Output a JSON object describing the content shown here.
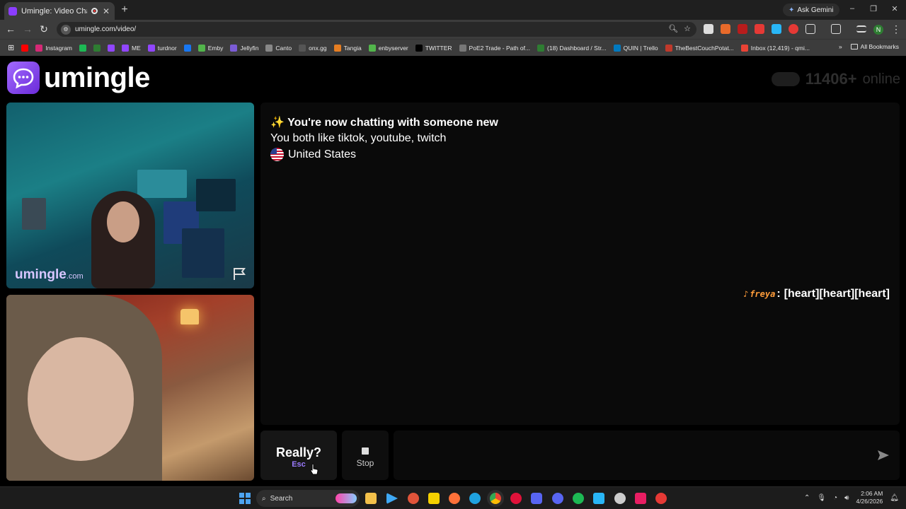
{
  "browser": {
    "tab_title": "Umingle: Video Chat with S",
    "tab_close": "✕",
    "new_tab": "+",
    "ask_gemini": "Ask Gemini",
    "url": "umingle.com/video/",
    "profile_initial": "N",
    "window_controls": [
      "–",
      "❐",
      "✕"
    ]
  },
  "bookmarks": {
    "items": [
      {
        "label": "",
        "color": "#ff0000"
      },
      {
        "label": "Instagram",
        "color": "#d62976"
      },
      {
        "label": "",
        "color": "#1db954"
      },
      {
        "label": "",
        "color": "#2e7d32"
      },
      {
        "label": "",
        "color": "#9146ff"
      },
      {
        "label": "ME",
        "color": "#9146ff"
      },
      {
        "label": "turdnor",
        "color": "#9146ff"
      },
      {
        "label": "",
        "color": "#1877f2"
      },
      {
        "label": "Emby",
        "color": "#52b54b"
      },
      {
        "label": "Jellyfin",
        "color": "#7b5cd6"
      },
      {
        "label": "Canto",
        "color": "#888888"
      },
      {
        "label": "onx.gg",
        "color": "#555555"
      },
      {
        "label": "Tangia",
        "color": "#e67e22"
      },
      {
        "label": "enbyserver",
        "color": "#52b54b"
      },
      {
        "label": "TWITTER",
        "color": "#000000"
      },
      {
        "label": "PoE2 Trade - Path of...",
        "color": "#777777"
      },
      {
        "label": "(18) Dashboard / Str...",
        "color": "#2e7d32"
      },
      {
        "label": "QUIN | Trello",
        "color": "#0079bf"
      },
      {
        "label": "TheBestCouchPotat...",
        "color": "#c0392b"
      },
      {
        "label": "Inbox (12,419) - qmi...",
        "color": "#ea4335"
      }
    ],
    "all_bookmarks": "All Bookmarks"
  },
  "site": {
    "logo_text": "umingle",
    "online_count": "11406+",
    "online_label": "online",
    "watermark_main": "umingle",
    "watermark_suffix": ".com"
  },
  "chat": {
    "sparkle": "✨",
    "line1": "You're now chatting with someone new",
    "line2": "You both like tiktok, youtube, twitch",
    "country": "United States",
    "message": {
      "sender": "freya",
      "text": "[heart][heart][heart]"
    }
  },
  "controls": {
    "really_label": "Really?",
    "really_shortcut": "Esc",
    "stop_label": "Stop",
    "message_placeholder": ""
  },
  "taskbar": {
    "search_label": "Search",
    "time": "2:06 AM",
    "date": "4/26/2026"
  },
  "colors": {
    "brand": "#8b3dff",
    "accent_shortcut": "#9b7bff",
    "sender_orange": "#ff9c3a"
  }
}
